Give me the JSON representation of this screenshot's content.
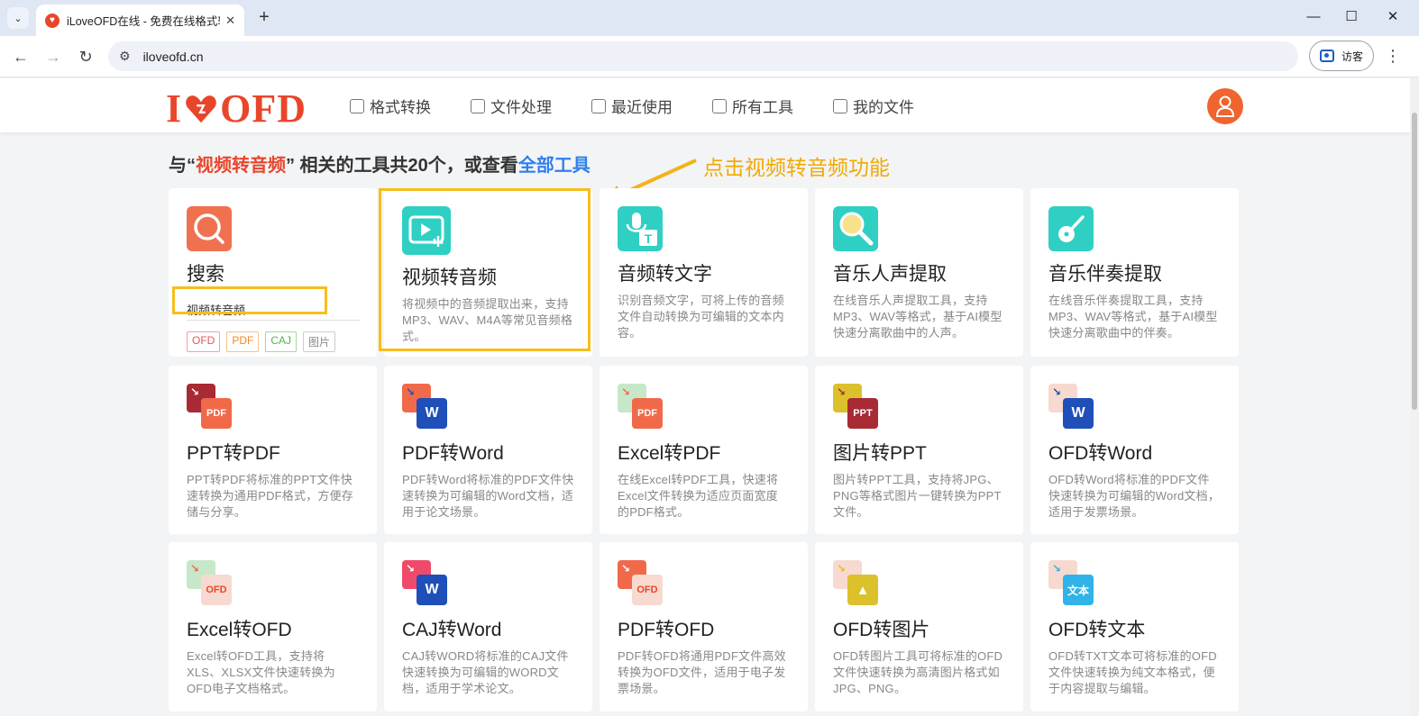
{
  "browser": {
    "tab_title": "iLoveOFD在线 - 免费在线格式转换",
    "url": "iloveofd.cn",
    "guest_label": "访客"
  },
  "site": {
    "logo_left": "I",
    "logo_right": "OFD",
    "nav": [
      {
        "label": "格式转换"
      },
      {
        "label": "文件处理"
      },
      {
        "label": "最近使用"
      },
      {
        "label": "所有工具"
      },
      {
        "label": "我的文件"
      }
    ]
  },
  "heading": {
    "prefix": "与“",
    "keyword": "视频转音频",
    "middle": "” 相关的工具共20个，或查看",
    "link": "全部工具"
  },
  "annotation": "点击视频转音频功能",
  "search_card": {
    "title": "搜索",
    "query": "视频转音频",
    "tags": [
      {
        "label": "OFD",
        "color": "#e85555"
      },
      {
        "label": "PDF",
        "color": "#f08a24"
      },
      {
        "label": "CAJ",
        "color": "#55b34a"
      },
      {
        "label": "图片",
        "color": "#888888"
      }
    ]
  },
  "tools": [
    {
      "title": "视频转音频",
      "desc": "将视频中的音频提取出来，支持MP3、WAV、M4A等常见音频格式。",
      "icon": "video-to-audio-icon"
    },
    {
      "title": "音频转文字",
      "desc": "识别音频文字，可将上传的音频文件自动转换为可编辑的文本内容。",
      "icon": "microphone-text-icon"
    },
    {
      "title": "音乐人声提取",
      "desc": "在线音乐人声提取工具，支持MP3、WAV等格式，基于AI模型快速分离歌曲中的人声。",
      "icon": "vocal-extract-icon"
    },
    {
      "title": "音乐伴奏提取",
      "desc": "在线音乐伴奏提取工具，支持MP3、WAV等格式，基于AI模型快速分离歌曲中的伴奏。",
      "icon": "guitar-icon"
    },
    {
      "title": "PPT转PDF",
      "desc": "PPT转PDF将标准的PPT文件快速转换为通用PDF格式，方便存储与分享。",
      "icon": "ppt-to-pdf-icon",
      "front": "PDF"
    },
    {
      "title": "PDF转Word",
      "desc": "PDF转Word将标准的PDF文件快速转换为可编辑的Word文档，适用于论文场景。",
      "icon": "pdf-to-word-icon",
      "front": "W"
    },
    {
      "title": "Excel转PDF",
      "desc": "在线Excel转PDF工具，快速将Excel文件转换为适应页面宽度的PDF格式。",
      "icon": "excel-to-pdf-icon",
      "front": "PDF"
    },
    {
      "title": "图片转PPT",
      "desc": "图片转PPT工具，支持将JPG、PNG等格式图片一键转换为PPT文件。",
      "icon": "image-to-ppt-icon",
      "front": "PPT"
    },
    {
      "title": "OFD转Word",
      "desc": "OFD转Word将标准的PDF文件快速转换为可编辑的Word文档，适用于发票场景。",
      "icon": "ofd-to-word-icon",
      "front": "W"
    },
    {
      "title": "Excel转OFD",
      "desc": "Excel转OFD工具，支持将XLS、XLSX文件快速转换为OFD电子文档格式。",
      "icon": "excel-to-ofd-icon",
      "front": "OFD"
    },
    {
      "title": "CAJ转Word",
      "desc": "CAJ转WORD将标准的CAJ文件快速转换为可编辑的WORD文档，适用于学术论文。",
      "icon": "caj-to-word-icon",
      "front": "W"
    },
    {
      "title": "PDF转OFD",
      "desc": "PDF转OFD将通用PDF文件高效转换为OFD文件，适用于电子发票场景。",
      "icon": "pdf-to-ofd-icon",
      "front": "OFD"
    },
    {
      "title": "OFD转图片",
      "desc": "OFD转图片工具可将标准的OFD文件快速转换为高清图片格式如JPG、PNG。",
      "icon": "ofd-to-image-icon",
      "front": "▲"
    },
    {
      "title": "OFD转文本",
      "desc": "OFD转TXT文本可将标准的OFD文件快速转换为纯文本格式，便于内容提取与编辑。",
      "icon": "ofd-to-text-icon",
      "front": "文本"
    }
  ]
}
